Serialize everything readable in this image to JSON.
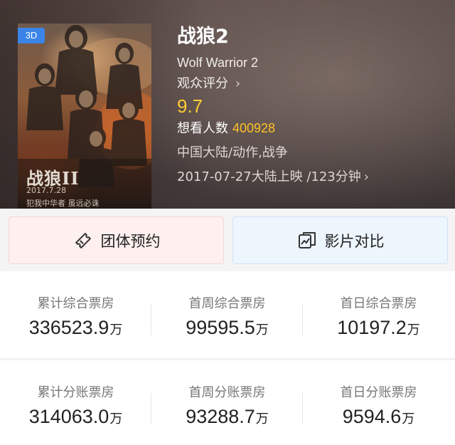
{
  "movie": {
    "badge": "3D",
    "title": "战狼2",
    "english_title": "Wolf Warrior 2",
    "rating_label": "观众评分",
    "score": "9.7",
    "want_label": "想看人数",
    "want_count": "400928",
    "genre": "中国大陆/动作,战争",
    "release": "2017-07-27大陆上映 /123分钟",
    "poster": {
      "title_art": "战狼II",
      "date": "2017.7.28",
      "slogan": "犯我中华者  虽远必诛"
    }
  },
  "actions": {
    "group_booking": "团体预约",
    "compare": "影片对比"
  },
  "stats": {
    "row1": [
      {
        "label": "累计综合票房",
        "value": "336523.9",
        "unit": "万"
      },
      {
        "label": "首周综合票房",
        "value": "99595.5",
        "unit": "万"
      },
      {
        "label": "首日综合票房",
        "value": "10197.2",
        "unit": "万"
      }
    ],
    "row2": [
      {
        "label": "累计分账票房",
        "value": "314063.0",
        "unit": "万"
      },
      {
        "label": "首周分账票房",
        "value": "93288.7",
        "unit": "万"
      },
      {
        "label": "首日分账票房",
        "value": "9594.6",
        "unit": "万"
      }
    ]
  },
  "colors": {
    "score": "#ffcc33",
    "want_count": "#ffc125",
    "badge_3d": "#3a84e8"
  },
  "icons": {
    "rating_chevron": "chevron-right-icon",
    "release_chevron": "chevron-right-icon",
    "group_booking": "ticket-icon",
    "compare": "compare-icon"
  }
}
